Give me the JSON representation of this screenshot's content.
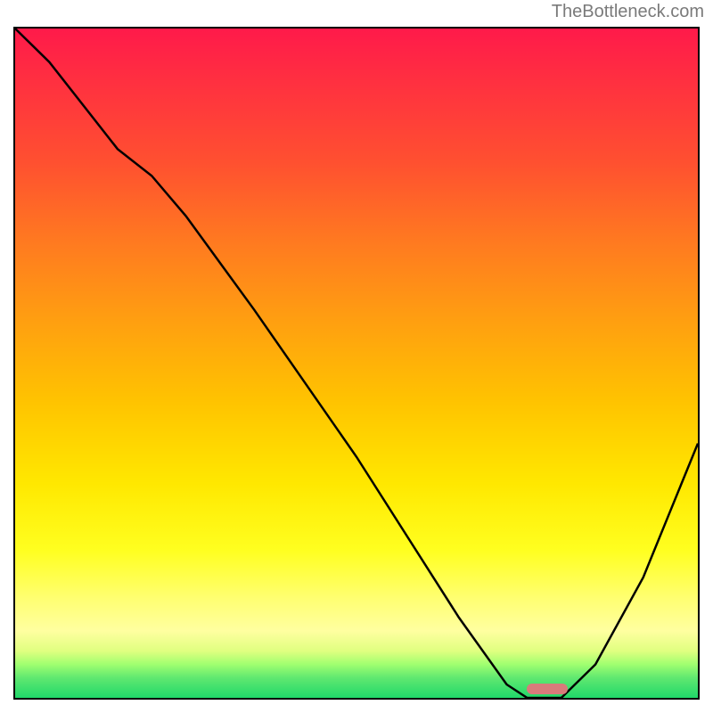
{
  "watermark": "TheBottleneck.com",
  "chart_data": {
    "type": "line",
    "title": "",
    "xlabel": "",
    "ylabel": "",
    "xlim": [
      0,
      100
    ],
    "ylim": [
      0,
      100
    ],
    "series": [
      {
        "name": "bottleneck-curve",
        "x": [
          0,
          5,
          15,
          20,
          25,
          35,
          50,
          65,
          72,
          75,
          80,
          85,
          92,
          100
        ],
        "values": [
          100,
          95,
          82,
          78,
          72,
          58,
          36,
          12,
          2,
          0,
          0,
          5,
          18,
          38
        ]
      }
    ],
    "optimal_range_x": [
      75,
      80
    ],
    "gradient_stops": [
      {
        "pct": 0,
        "color": "#ff1a4a"
      },
      {
        "pct": 20,
        "color": "#ff5030"
      },
      {
        "pct": 44,
        "color": "#ffa010"
      },
      {
        "pct": 68,
        "color": "#ffe800"
      },
      {
        "pct": 90,
        "color": "#ffffa0"
      },
      {
        "pct": 100,
        "color": "#20d86a"
      }
    ]
  }
}
